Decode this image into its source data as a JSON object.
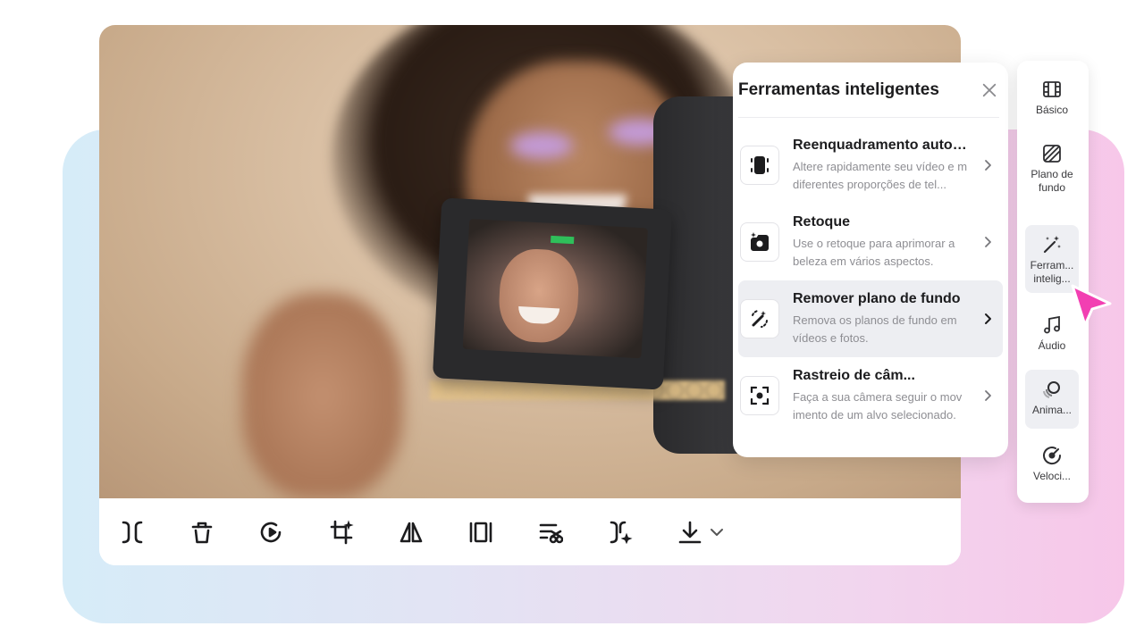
{
  "panel": {
    "title": "Ferramentas inteligentes",
    "items": [
      {
        "name": "Reenquadramento autom...",
        "description": "Altere rapidamente seu vídeo e m diferentes proporções de tel...",
        "icon": "reframe-icon"
      },
      {
        "name": "Retoque",
        "description": "Use o retoque para aprimorar a beleza em vários aspectos.",
        "icon": "retouch-icon"
      },
      {
        "name": "Remover plano de fundo",
        "description": "Remova os planos de fundo em vídeos e fotos.",
        "icon": "remove-background-icon"
      },
      {
        "name": "Rastreio de câm...",
        "description": "Faça a sua câmera seguir o mov imento de um alvo selecionado.",
        "icon": "camera-tracking-icon"
      }
    ]
  },
  "rail": {
    "items": [
      {
        "label": "Básico",
        "icon": "film-icon"
      },
      {
        "label": "Plano de fundo",
        "icon": "background-icon"
      },
      {
        "label": "Ferram... intelig...",
        "icon": "magic-wand-icon"
      },
      {
        "label": "Áudio",
        "icon": "music-note-icon"
      },
      {
        "label": "Anima...",
        "icon": "animation-icon"
      },
      {
        "label": "Veloci...",
        "icon": "speed-icon"
      }
    ]
  },
  "toolbar": {
    "icons": [
      "split-icon",
      "delete-icon",
      "replay-icon",
      "crop-icon",
      "mirror-icon",
      "freeze-frame-icon",
      "remove-audio-icon",
      "smart-split-icon",
      "download-icon",
      "chevron-down-icon"
    ]
  },
  "colors": {
    "accent_pink": "#f23fb2",
    "gradient_left": "#d6ecf8",
    "gradient_right": "#f7c7e9"
  }
}
